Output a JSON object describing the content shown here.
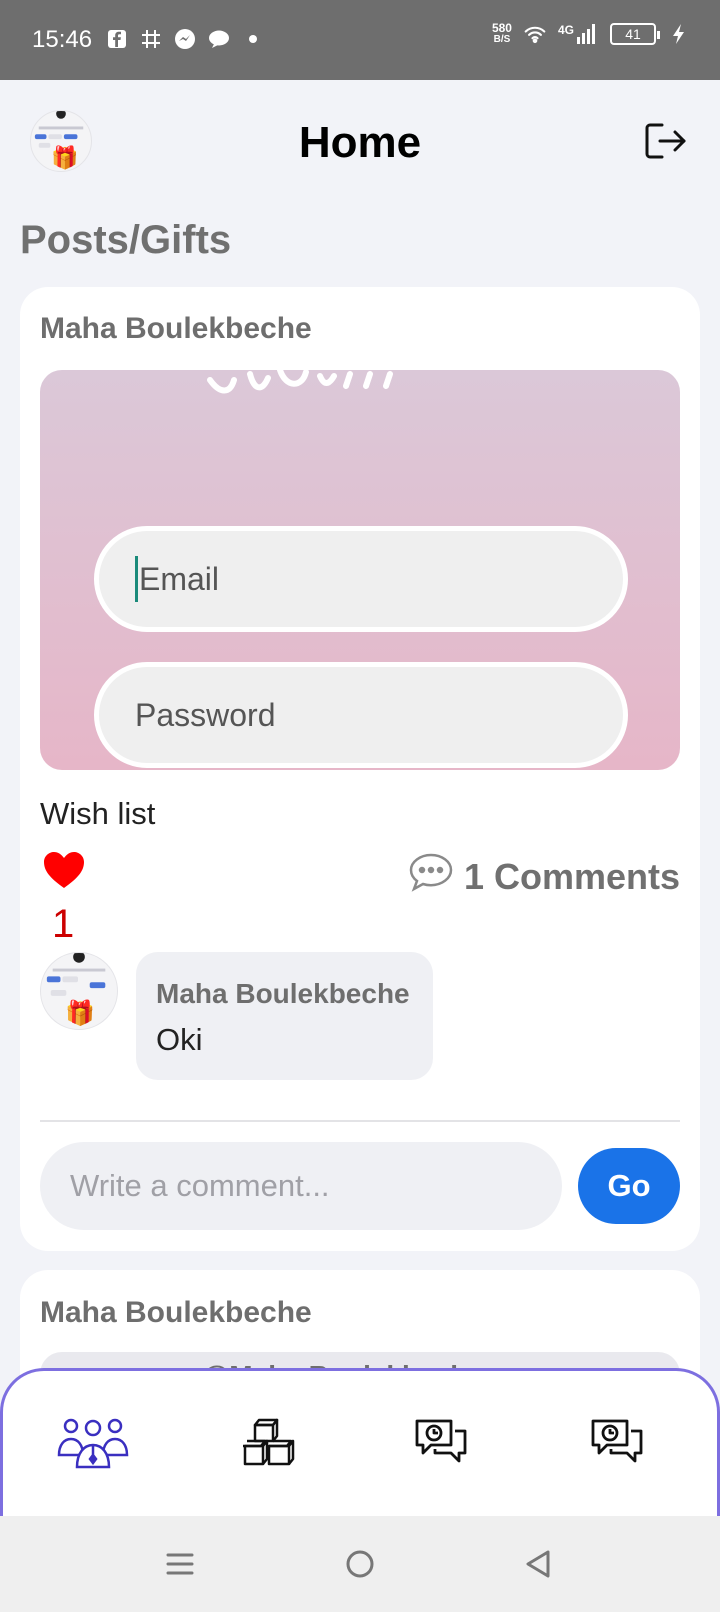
{
  "status_bar": {
    "time": "15:46",
    "net_speed_value": "580",
    "net_speed_unit": "B/S",
    "network": "4G",
    "battery": "41"
  },
  "header": {
    "title": "Home"
  },
  "section_title": "Posts/Gifts",
  "post": {
    "author": "Maha Boulekbeche",
    "image": {
      "email_placeholder": "Email",
      "password_placeholder": "Password"
    },
    "caption": "Wish list",
    "likes": "1",
    "comments_label": "1 Comments",
    "comments": [
      {
        "author": "Maha Boulekbeche",
        "text": "Oki"
      }
    ],
    "comment_input_placeholder": "Write a comment...",
    "go_label": "Go"
  },
  "post2": {
    "author": "Maha Boulekbeche",
    "image_handle": "@Maha Boulekbeche"
  },
  "bottom_nav": {
    "items": [
      {
        "icon": "users-icon",
        "active": true
      },
      {
        "icon": "boxes-icon",
        "active": false
      },
      {
        "icon": "chat-clock-icon",
        "active": false
      },
      {
        "icon": "chat-clock-icon",
        "active": false
      }
    ]
  },
  "colors": {
    "accent": "#1a73e8",
    "nav_active": "#3a2fc0",
    "nav_border": "#7d6fe0",
    "heart": "#ff0000"
  }
}
